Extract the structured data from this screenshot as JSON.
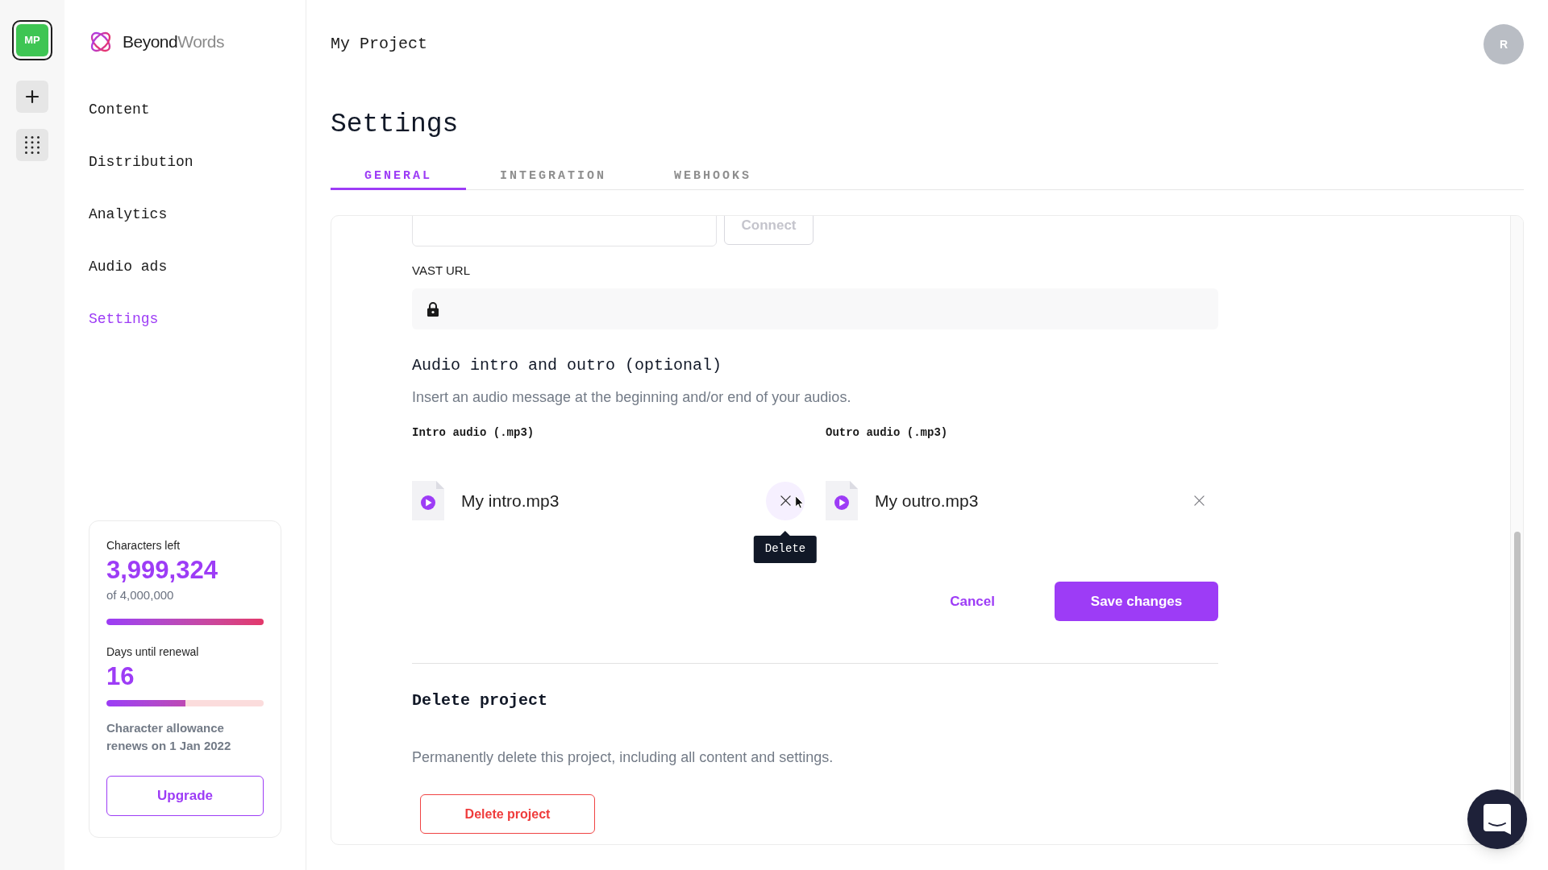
{
  "rail": {
    "project_badge": "MP"
  },
  "sidebar": {
    "brand": [
      {
        "text": "Beyond",
        "color": "#1c1c1c"
      },
      {
        "text": "Words",
        "color": "#8b8b8b"
      }
    ],
    "nav": [
      {
        "label": "Content",
        "selected": false
      },
      {
        "label": "Distribution",
        "selected": false
      },
      {
        "label": "Analytics",
        "selected": false
      },
      {
        "label": "Audio ads",
        "selected": false
      },
      {
        "label": "Settings",
        "selected": true
      }
    ],
    "usage": {
      "characters_label": "Characters left",
      "characters_value": "3,999,324",
      "characters_total": "of 4,000,000",
      "characters_bar": {
        "level": 1
      },
      "days_label": "Days until renewal",
      "days_value": "16",
      "days_bar": {
        "level": 0.5
      },
      "note": "Character allowance renews on 1 Jan 2022",
      "upgrade_button": "Upgrade"
    }
  },
  "header": {
    "project": "My Project",
    "avatar": "R"
  },
  "page_title": "Settings",
  "tabs": [
    {
      "label": "GENERAL",
      "selected": true
    },
    {
      "label": "INTEGRATION",
      "selected": false
    },
    {
      "label": "WEBHOOKS",
      "selected": false
    }
  ],
  "form": {
    "connect_button": {
      "label": "Connect",
      "disabled": true
    },
    "vast_url": {
      "label": "VAST URL",
      "locked": true
    },
    "audio": {
      "title": "Audio intro and outro (optional)",
      "description": "Insert an audio message at the beginning and/or end of your audios.",
      "files": [
        {
          "label": "Intro audio (.mp3)",
          "file": "My intro.mp3",
          "hovered": true,
          "tooltip": "Delete"
        },
        {
          "label": "Outro audio (.mp3)",
          "file": "My outro.mp3",
          "hovered": false
        }
      ]
    },
    "actions": {
      "cancel": "Cancel",
      "save": "Save changes"
    },
    "danger": {
      "title": "Delete project",
      "description": "Permanently delete this project, including all content and settings.",
      "button": "Delete project"
    }
  }
}
